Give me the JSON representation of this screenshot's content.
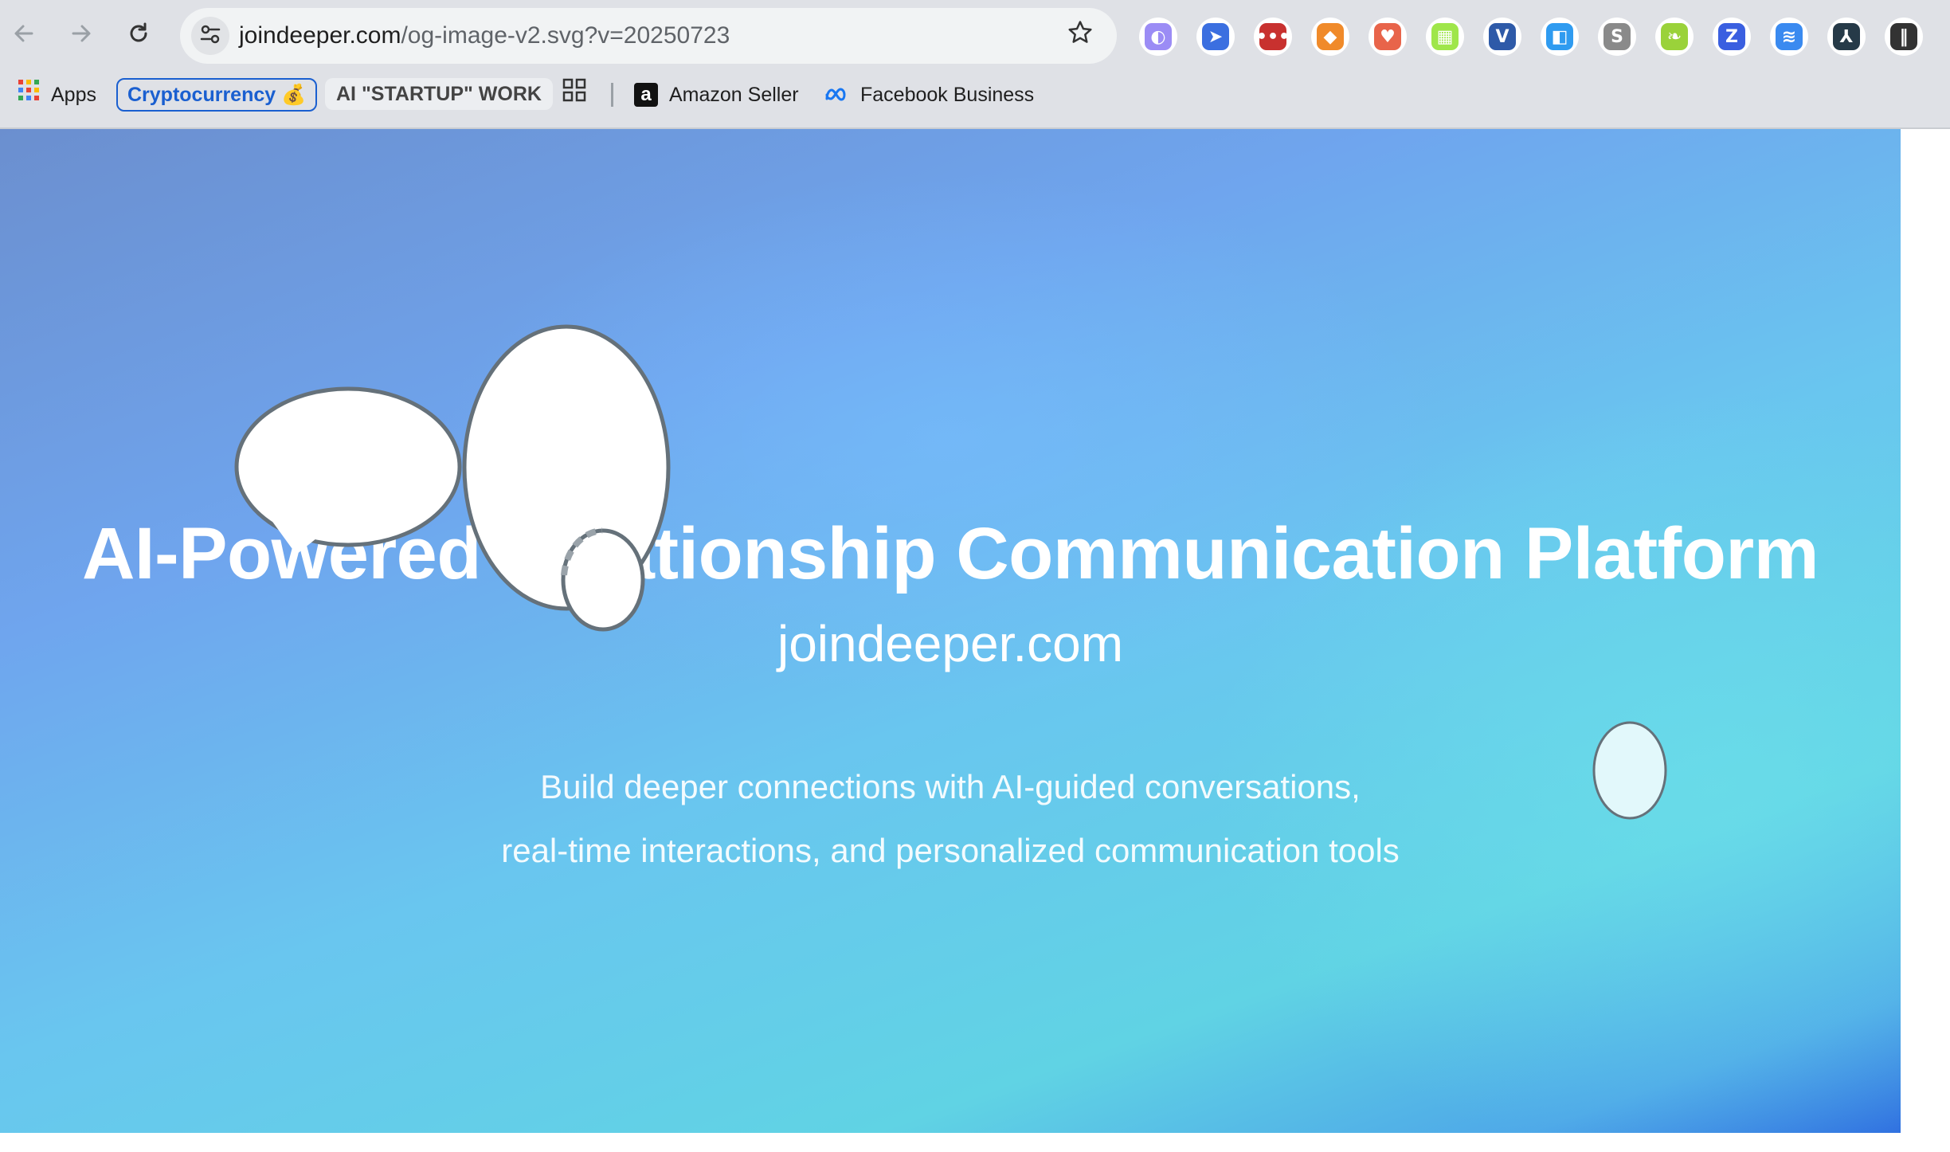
{
  "browser": {
    "url_host": "joindeeper.com",
    "url_path": "/og-image-v2.svg?v=20250723",
    "extensions": [
      {
        "name": "ghost-extension-icon",
        "color": "#9b8cf5",
        "glyph": "◐"
      },
      {
        "name": "paper-plane-extension-icon",
        "color": "#3b6fe0",
        "glyph": "➤"
      },
      {
        "name": "lastpass-extension-icon",
        "color": "#c8312f",
        "glyph": "•••"
      },
      {
        "name": "metamask-extension-icon",
        "color": "#f08a2a",
        "glyph": "◆"
      },
      {
        "name": "heart-extension-icon",
        "color": "#e8644a",
        "glyph": "♥"
      },
      {
        "name": "grid-extension-icon",
        "color": "#9fe64a",
        "glyph": "▦"
      },
      {
        "name": "v-extension-icon",
        "color": "#2e5aa8",
        "glyph": "V"
      },
      {
        "name": "square-extension-icon",
        "color": "#2f9bf0",
        "glyph": "◧"
      },
      {
        "name": "s-extension-icon",
        "color": "#8a8a8a",
        "glyph": "S"
      },
      {
        "name": "leaf-extension-icon",
        "color": "#9ad23a",
        "glyph": "❧"
      },
      {
        "name": "z-extension-icon",
        "color": "#3a5fe0",
        "glyph": "Z"
      },
      {
        "name": "wave-extension-icon",
        "color": "#3a8af0",
        "glyph": "≋"
      },
      {
        "name": "person-extension-icon",
        "color": "#263a48",
        "glyph": "⅄"
      },
      {
        "name": "bars-extension-icon",
        "color": "#333333",
        "glyph": "‖"
      }
    ]
  },
  "bookmarks": {
    "apps": "Apps",
    "crypto": "Cryptocurrency 💰",
    "ai_work": "AI \"STARTUP\" WORK",
    "amazon": "Amazon Seller",
    "facebook": "Facebook Business"
  },
  "page": {
    "headline": "AI-Powered Relationship Communication Platform",
    "domain": "joindeeper.com",
    "tagline_1": "Build deeper connections with AI-guided conversations,",
    "tagline_2": "real-time interactions, and personalized communication tools"
  },
  "colors": {
    "bubble_stroke": "#65717a",
    "bubble_fill": "#ffffff",
    "small_bubble_fill": "#e2f8fb"
  }
}
